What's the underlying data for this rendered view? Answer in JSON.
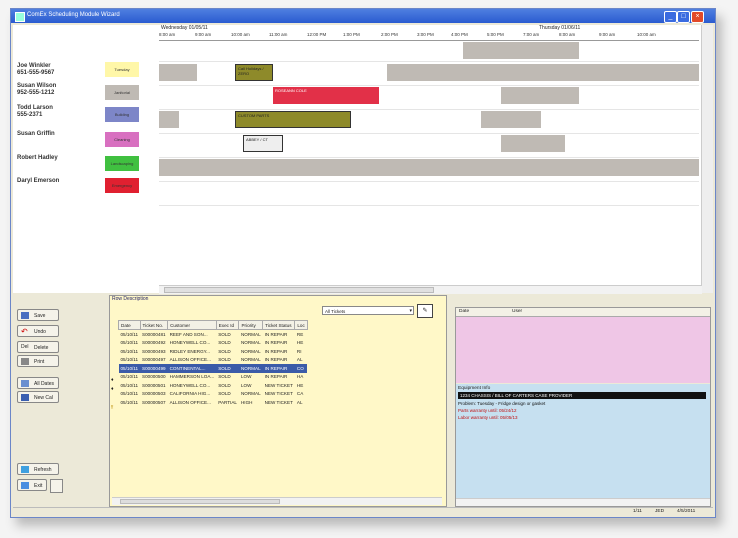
{
  "window": {
    "title": "ComEx Scheduling Module Wizard"
  },
  "schedule": {
    "dates": {
      "left": "Wednesday 01/05/11",
      "right": "Thursday 01/06/11"
    },
    "times": [
      "8:00 am",
      "9:00 am",
      "10:00 am",
      "11:00 am",
      "12:00 PM",
      "1:00 PM",
      "2:00 PM",
      "3:00 PM",
      "4:00 PM",
      "5:00 PM",
      "7:00 am",
      "8:00 am",
      "9:00 am",
      "10:00 am"
    ],
    "people": [
      {
        "name": "Joe Winkler",
        "phone": "651-555-9567",
        "swatch_label": "Tuesday",
        "color": "#fff7a8"
      },
      {
        "name": "Susan Wilson",
        "phone": "952-555-1212",
        "swatch_label": "Janitorial",
        "color": "#bfbab4"
      },
      {
        "name": "Todd Larson",
        "phone": "555-2371",
        "swatch_label": "Building",
        "color": "#7d86c8"
      },
      {
        "name": "Susan Griffin",
        "phone": "",
        "swatch_label": "Cleaning",
        "color": "#d870c0"
      },
      {
        "name": "Robert Hadley",
        "phone": "",
        "swatch_label": "Landscaping",
        "color": "#40c040"
      },
      {
        "name": "Daryl Emerson",
        "phone": "",
        "swatch_label": "Emergency",
        "color": "#e02030"
      }
    ],
    "appointments": [
      {
        "label": "Call Holidays / ZERO",
        "cls": "olive"
      },
      {
        "label": "ROSEANN COLE",
        "cls": "red"
      },
      {
        "label": "CUSTOM PARTS",
        "cls": "olive"
      },
      {
        "label": "ABBEY / CT",
        "cls": "white"
      }
    ]
  },
  "actions": [
    "Undo",
    "Delete",
    "Print",
    "All Dates",
    "New Cal",
    "Refresh",
    "Exit"
  ],
  "actions_top": "Save",
  "tickets": {
    "row_description": "Row Description",
    "filter": "All Tickets",
    "columns": [
      "Date",
      "Ticket No.",
      "Customer",
      "Exec Id",
      "Priority",
      "Ticket Status",
      "Loc"
    ],
    "rows": [
      [
        "05/10/11",
        "S00000481",
        "REEF AND SON...",
        "SOLD",
        "NORMAL",
        "IN REPAIR",
        "RE"
      ],
      [
        "05/10/11",
        "S00000492",
        "HONEYWELL CO...",
        "SOLD",
        "NORMAL",
        "IN REPAIR",
        "HE"
      ],
      [
        "05/10/11",
        "S00000493",
        "RIDLEY ENERGY...",
        "SOLD",
        "NORMAL",
        "IN REPAIR",
        "RI"
      ],
      [
        "05/10/11",
        "S00000497",
        "ALLISON OFFICE...",
        "SOLD",
        "NORMAL",
        "IN REPAIR",
        "AL"
      ],
      [
        "05/10/11",
        "S00000499",
        "CONTINENTAL...",
        "SOLD",
        "NORMAL",
        "IN REPAIR",
        "CO"
      ],
      [
        "05/10/11",
        "S00000500",
        "HAMMERSON LOA...",
        "SOLD",
        "LOW",
        "IN REPAIR",
        "HA"
      ],
      [
        "05/10/11",
        "S00000501",
        "HONEYWELL CO...",
        "SOLD",
        "LOW",
        "NEW TICKET",
        "HE"
      ],
      [
        "05/10/11",
        "S00000503",
        "CALIFORNIA HIG...",
        "SOLD",
        "NORMAL",
        "NEW TICKET",
        "CA"
      ],
      [
        "05/10/11",
        "S00000507",
        "ALLISON OFFICE...",
        "PARTIAL",
        "HIGH",
        "NEW TICKET",
        "AL"
      ]
    ]
  },
  "details": {
    "col_date": "Date",
    "col_user": "User",
    "equipment_label": "Equipment Info",
    "equipment_selected": "1234 CHASSIS / BILL OF CARTERS CASE PROVIDER",
    "lines": [
      {
        "text": "Problem: Tuesday - Fridge design or gasket",
        "color": "#111"
      },
      {
        "text": "Parts warranty until: 05/24/12",
        "color": "#c01010"
      },
      {
        "text": "Labor warranty until: 05/05/13",
        "color": "#c01010"
      }
    ]
  },
  "status": {
    "a": "1/11",
    "b": "JED",
    "c": "4/5/2011"
  }
}
